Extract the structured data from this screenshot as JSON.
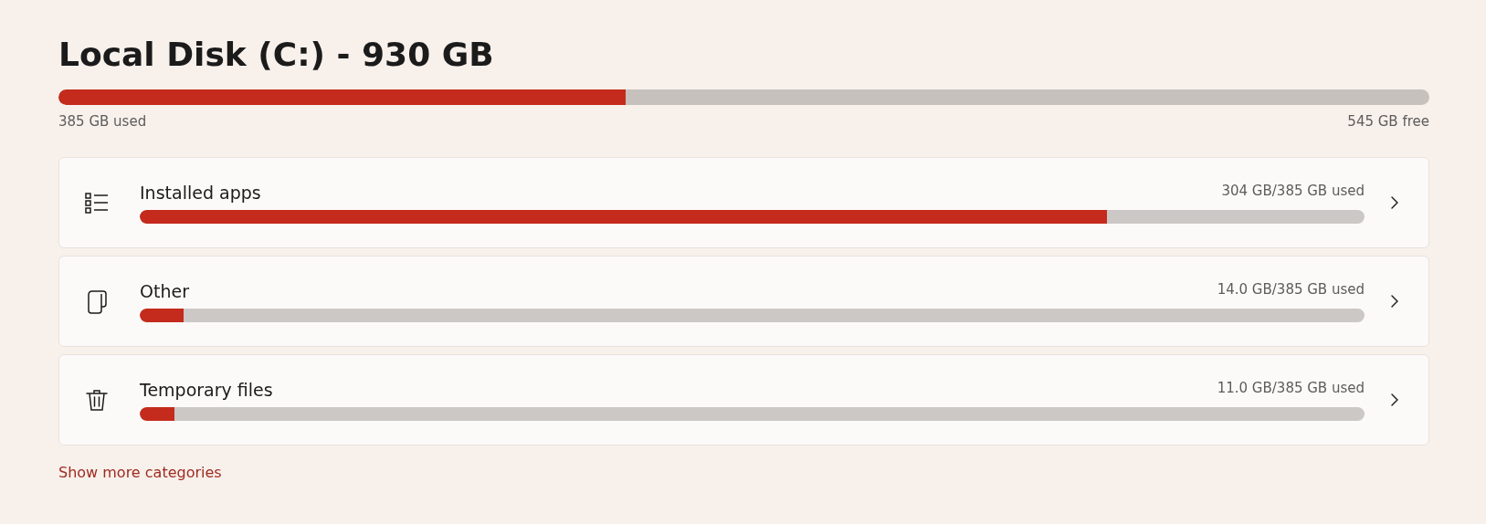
{
  "title": "Local Disk (C:) - 930 GB",
  "disk": {
    "level": 0.414,
    "used": "385 GB used",
    "free": "545 GB free"
  },
  "categories": [
    {
      "kind": "apps",
      "label": "Installed apps",
      "usage": "304 GB/385 GB used",
      "level": 0.79
    },
    {
      "kind": "other",
      "label": "Other",
      "usage": "14.0 GB/385 GB used",
      "level": 0.036
    },
    {
      "kind": "temp",
      "label": "Temporary files",
      "usage": "11.0 GB/385 GB used",
      "level": 0.028
    }
  ],
  "more_link": "Show more categories"
}
